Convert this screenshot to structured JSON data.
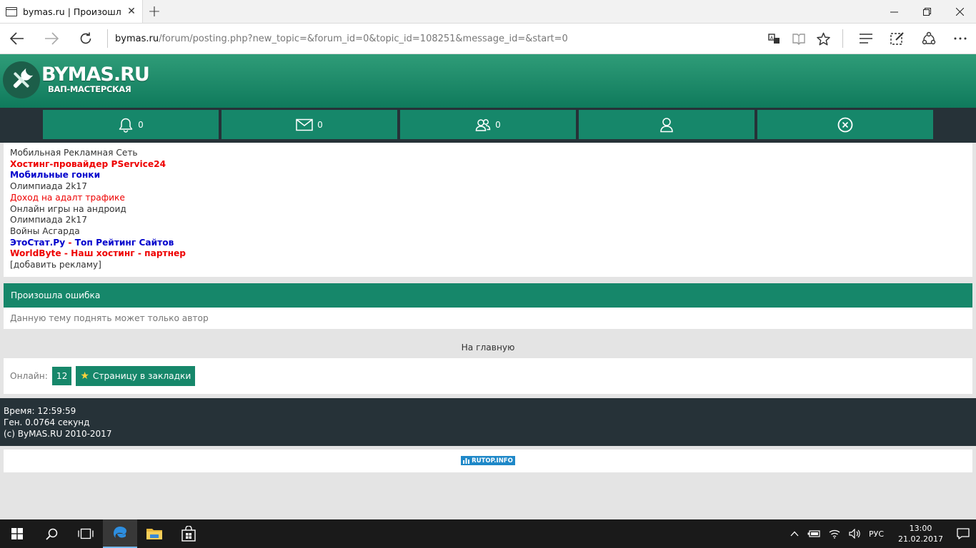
{
  "browser": {
    "tab_title": "bymas.ru | Произошла",
    "url_host": "bymas.ru",
    "url_rest": "/forum/posting.php?new_topic=&forum_id=0&topic_id=108251&message_id=&start=0"
  },
  "site": {
    "logo_title": "BYMAS.RU",
    "logo_subtitle": "ВАП-МАСТЕРСКАЯ",
    "nav": [
      {
        "icon": "bell-icon",
        "count": "0"
      },
      {
        "icon": "mail-icon",
        "count": "0"
      },
      {
        "icon": "users-icon",
        "count": "0"
      },
      {
        "icon": "user-icon",
        "count": ""
      },
      {
        "icon": "close-circle-icon",
        "count": ""
      }
    ]
  },
  "ads": [
    {
      "text": "Мобильная Рекламная Сеть",
      "style": "plain"
    },
    {
      "text": "Хостинг-провайдер PService24",
      "style": "bold-red"
    },
    {
      "text": "Мобильные гонки",
      "style": "bold-blue"
    },
    {
      "text": "Олимпиада 2k17",
      "style": "plain"
    },
    {
      "text": "Доход на адалт трафике",
      "style": "red"
    },
    {
      "text": "Онлайн игры на андроид",
      "style": "plain"
    },
    {
      "text": "Олимпиада 2k17",
      "style": "plain"
    },
    {
      "text": "Войны Асгарда",
      "style": "plain"
    },
    {
      "part1": "ЭтоСтат.Ру",
      "sep": " - ",
      "part2": "Топ Рейтинг Сайтов",
      "style": "mixed-blue"
    },
    {
      "part1": "WorldByte",
      "sep": " - ",
      "part2": "Наш хостинг - партнер",
      "style": "mixed-red"
    },
    {
      "text": "[добавить рекламу]",
      "style": "plain"
    }
  ],
  "error": {
    "title": "Произошла ошибка",
    "message": "Данную тему поднять может только автор"
  },
  "home_link": "На главную",
  "online": {
    "label": "Онлайн:",
    "count": "12",
    "bookmark_label": "Страницу в закладки"
  },
  "footer": {
    "time": "Время: 12:59:59",
    "gen": "Ген. 0.0764 секунд",
    "copyright": "(c) ByMAS.RU 2010-2017"
  },
  "counter_label": "RUTOP.INFO",
  "taskbar": {
    "lang": "РУС",
    "time": "13:00",
    "date": "21.02.2017"
  },
  "colors": {
    "accent": "#16876a",
    "dark": "#263238"
  }
}
